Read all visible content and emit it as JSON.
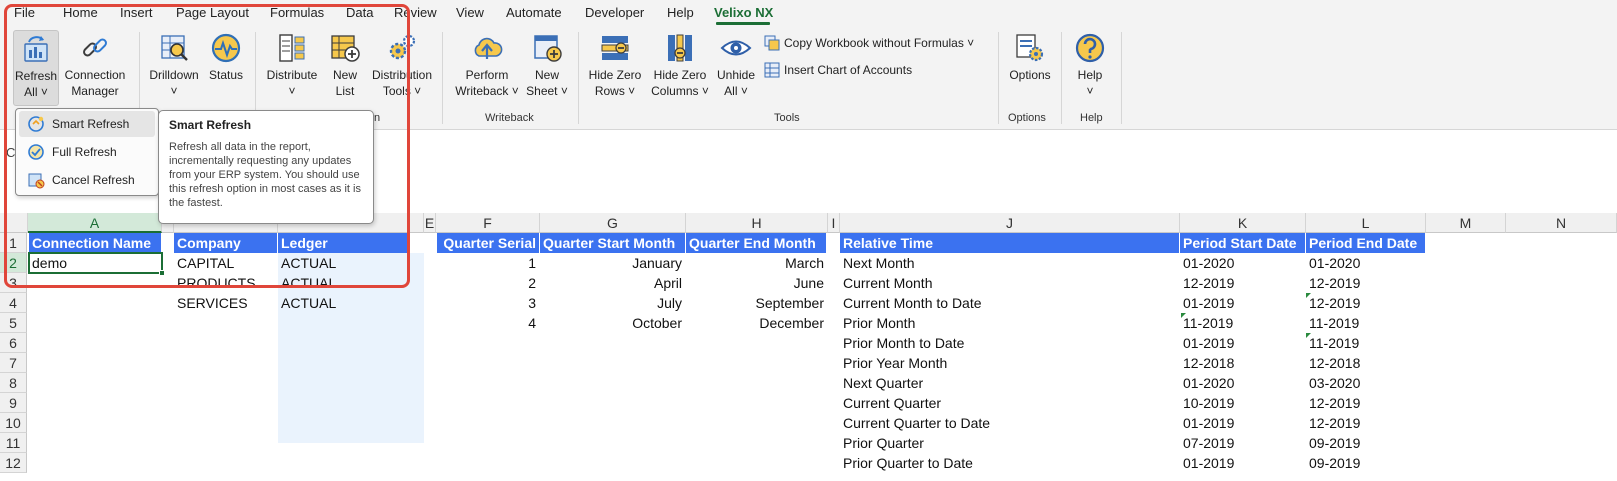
{
  "menu": [
    "File",
    "Home",
    "Insert",
    "Page Layout",
    "Formulas",
    "Data",
    "Review",
    "View",
    "Automate",
    "Developer",
    "Help",
    "Velixo NX"
  ],
  "ribbon": {
    "refresh_all": "Refresh\nAll ˅",
    "connection_manager": "Connection\nManager",
    "drilldown": "Drilldown\n˅",
    "status": "Status",
    "distribute": "Distribute\n˅",
    "new_list": "New\nList",
    "distribution_tools": "Distribution\nTools ˅",
    "perform_writeback": "Perform\nWriteback ˅",
    "new_sheet": "New\nSheet ˅",
    "hide_zero_rows": "Hide Zero\nRows ˅",
    "hide_zero_columns": "Hide Zero\nColumns ˅",
    "unhide_all": "Unhide\nAll ˅",
    "copy_workbook": "Copy Workbook without Formulas ˅",
    "insert_coa": "Insert Chart of Accounts",
    "options": "Options",
    "help": "Help\n˅",
    "groups": {
      "distribution_partial": "n",
      "writeback": "Writeback",
      "tools": "Tools",
      "options": "Options",
      "help": "Help"
    }
  },
  "dropdown": {
    "items": [
      "Smart Refresh",
      "Full Refresh",
      "Cancel Refresh"
    ]
  },
  "tooltip": {
    "title": "Smart Refresh",
    "body": "Refresh all data in the report, incrementally requesting any updates from your ERP system. You should use this refresh option in most cases as it is the fastest."
  },
  "formula_area": {
    "namebox_partial": "C"
  },
  "grid": {
    "columns": [
      "A",
      "E",
      "F",
      "G",
      "H",
      "I",
      "J",
      "K",
      "L",
      "M",
      "N"
    ],
    "rows": [
      "1",
      "2",
      "3",
      "4",
      "5",
      "6",
      "7",
      "8",
      "9",
      "10",
      "11",
      "12"
    ],
    "headers": {
      "connection_name": "Connection Name",
      "company": "Company",
      "ledger": "Ledger",
      "quarter_serial": "Quarter Serial",
      "quarter_start_month": "Quarter Start Month",
      "quarter_end_month": "Quarter End Month",
      "relative_time": "Relative Time",
      "period_start_date": "Period Start Date",
      "period_end_date": "Period End Date"
    },
    "connection_value": "demo",
    "companies": [
      "CAPITAL",
      "PRODUCTS",
      "SERVICES"
    ],
    "ledgers": [
      "ACTUAL",
      "ACTUAL",
      "ACTUAL"
    ],
    "quarters": [
      {
        "serial": "1",
        "start": "January",
        "end": "March"
      },
      {
        "serial": "2",
        "start": "April",
        "end": "June"
      },
      {
        "serial": "3",
        "start": "July",
        "end": "September"
      },
      {
        "serial": "4",
        "start": "October",
        "end": "December"
      }
    ],
    "relative": [
      {
        "name": "Next Month",
        "start": "01-2020",
        "end": "01-2020"
      },
      {
        "name": "Current Month",
        "start": "12-2019",
        "end": "12-2019"
      },
      {
        "name": "Current Month to Date",
        "start": "01-2019",
        "end": "12-2019"
      },
      {
        "name": "Prior Month",
        "start": "11-2019",
        "end": "11-2019"
      },
      {
        "name": "Prior Month to Date",
        "start": "01-2019",
        "end": "11-2019"
      },
      {
        "name": "Prior Year Month",
        "start": "12-2018",
        "end": "12-2018"
      },
      {
        "name": "Next Quarter",
        "start": "01-2020",
        "end": "03-2020"
      },
      {
        "name": "Current Quarter",
        "start": "10-2019",
        "end": "12-2019"
      },
      {
        "name": "Current Quarter to Date",
        "start": "01-2019",
        "end": "12-2019"
      },
      {
        "name": "Prior Quarter",
        "start": "07-2019",
        "end": "09-2019"
      },
      {
        "name": "Prior Quarter to Date",
        "start": "01-2019",
        "end": "09-2019"
      }
    ]
  },
  "colors": {
    "header_fill": "#3b72f0",
    "accent": "#1b6e35",
    "highlight": "#e0463a"
  }
}
